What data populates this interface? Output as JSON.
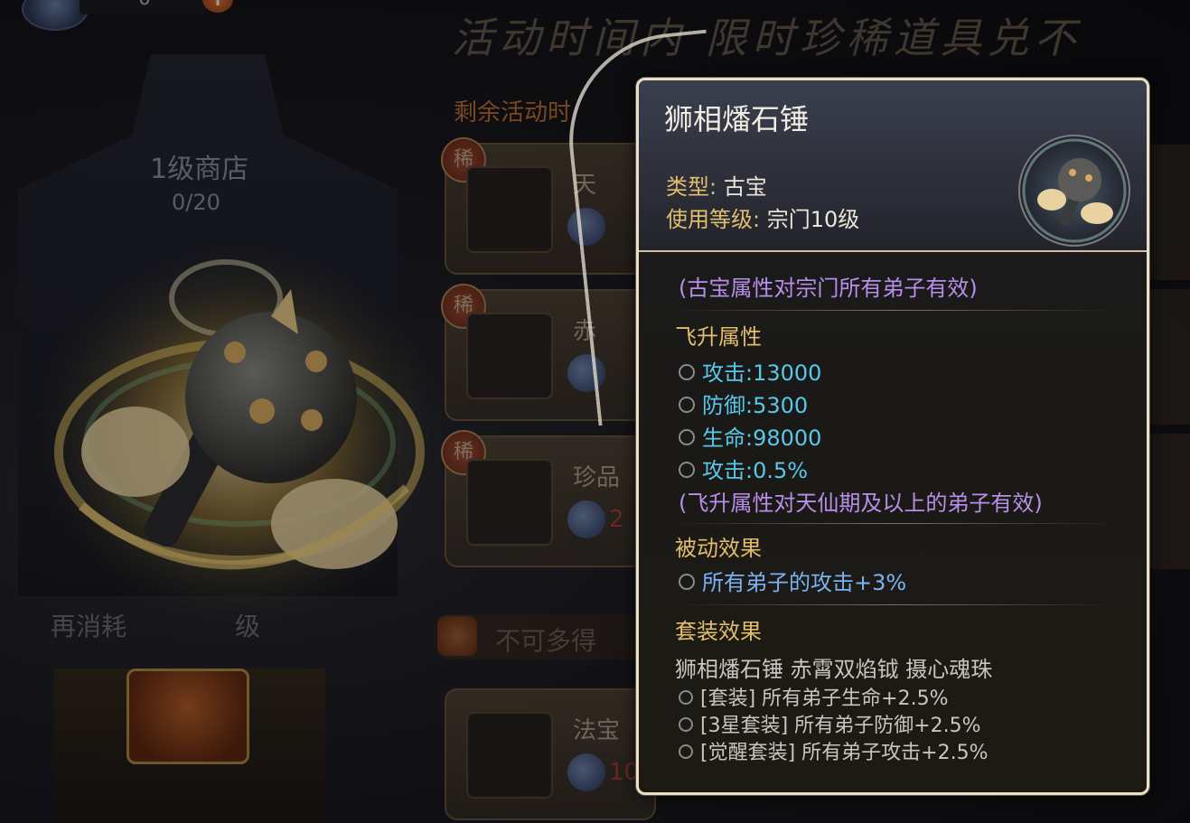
{
  "currency": {
    "amount": "0",
    "add_symbol": "+"
  },
  "banner": "活动时间内 限时珍稀道具兑不",
  "remaining_label": "剩余活动时",
  "shop": {
    "level": "1级商店",
    "progress": "0/20",
    "consume_prefix": "再消耗",
    "consume_suffix": "级"
  },
  "cards": [
    {
      "rare_label": "稀",
      "name": "天",
      "price": ""
    },
    {
      "rare_label": "稀",
      "name": "赤",
      "price": ""
    },
    {
      "rare_label": "稀",
      "name": "珍品",
      "price": "2"
    },
    {
      "rare_label": "",
      "name": "法宝",
      "price": "10"
    }
  ],
  "no_multi_label": "不可多得",
  "tooltip": {
    "title": "狮相燔石锤",
    "type_key": "类型:",
    "type_value": "古宝",
    "level_key": "使用等级:",
    "level_value": "宗门10级",
    "scope_note": "(古宝属性对宗门所有弟子有效)",
    "ascend_title": "飞升属性",
    "ascend_stats": [
      {
        "key": "攻击:",
        "value": "13000"
      },
      {
        "key": "防御:",
        "value": "5300"
      },
      {
        "key": "生命:",
        "value": "98000"
      },
      {
        "key": "攻击:",
        "value": "0.5%"
      }
    ],
    "ascend_note": "(飞升属性对天仙期及以上的弟子有效)",
    "passive_title": "被动效果",
    "passive_effect": "所有弟子的攻击+3%",
    "set_title": "套装效果",
    "set_members": "狮相燔石锤 赤霄双焰钺 摄心魂珠",
    "set_effects": [
      "[套装] 所有弟子生命+2.5%",
      "[3星套装] 所有弟子防御+2.5%",
      "[觉醒套装] 所有弟子攻击+2.5%"
    ]
  },
  "colors": {
    "section_gold": "#e2bd6c",
    "note_purple": "#b78fe8",
    "stat_cyan": "#58c7e9",
    "passive_blue": "#7ab3f2",
    "tooltip_border": "#e9dfc7"
  }
}
